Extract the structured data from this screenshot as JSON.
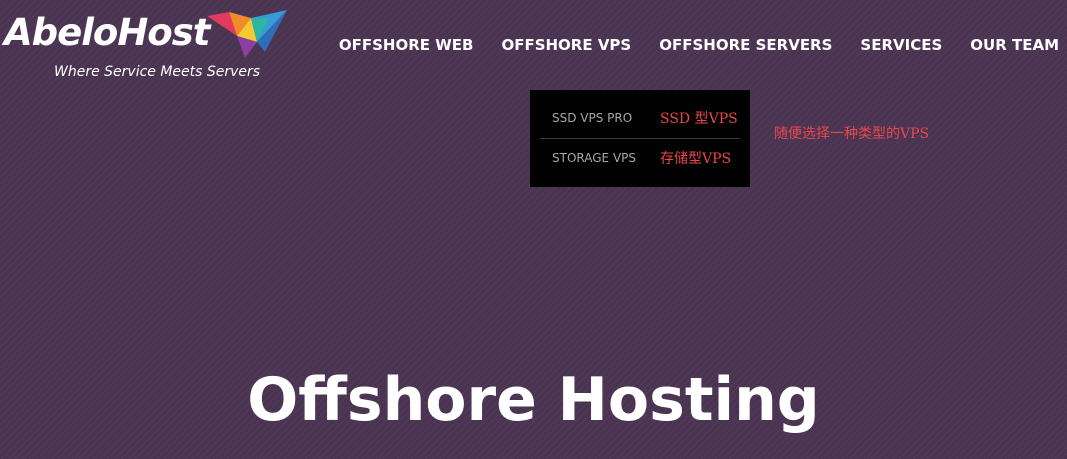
{
  "logo": {
    "name": "AbeloHost",
    "tagline": "Where Service Meets Servers",
    "icon": "origami-bird-icon"
  },
  "nav": {
    "items": [
      {
        "label": "OFFSHORE WEB"
      },
      {
        "label": "OFFSHORE VPS"
      },
      {
        "label": "OFFSHORE SERVERS"
      },
      {
        "label": "SERVICES"
      },
      {
        "label": "OUR TEAM"
      }
    ]
  },
  "dropdown": {
    "items": [
      {
        "label": "SSD VPS PRO",
        "annotation": "SSD 型VPS"
      },
      {
        "label": "STORAGE VPS",
        "annotation": "存储型VPS"
      }
    ]
  },
  "side_annotation": "随便选择一种类型的VPS",
  "hero": {
    "title": "Offshore Hosting"
  },
  "colors": {
    "background": "#4a3452",
    "dropdown_background": "#020202",
    "annotation": "#e8474b",
    "text": "#ffffff"
  }
}
